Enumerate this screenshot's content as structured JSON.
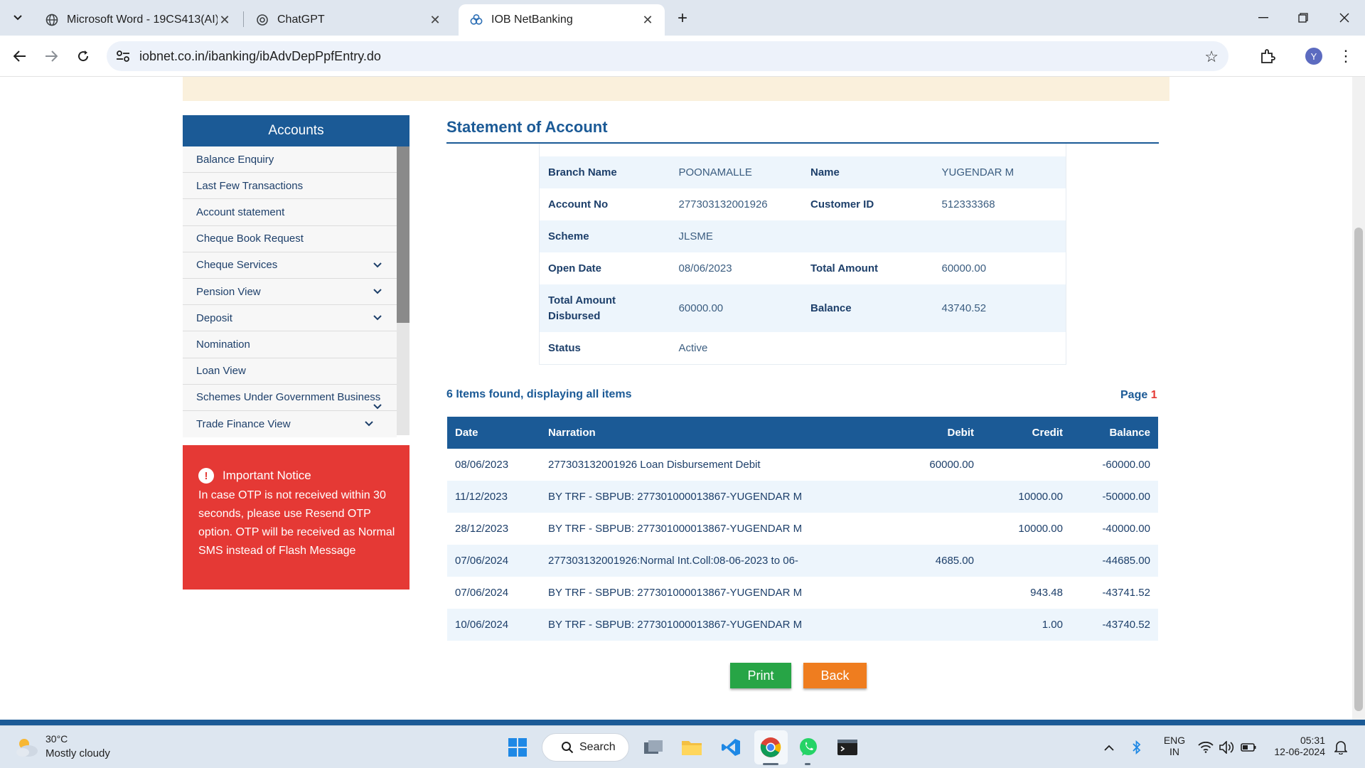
{
  "browser": {
    "tabs": [
      {
        "title": "Microsoft Word - 19CS413(AI)_",
        "icon": "globe-icon"
      },
      {
        "title": "ChatGPT",
        "icon": "chatgpt-icon"
      },
      {
        "title": "IOB NetBanking",
        "icon": "iob-logo-icon"
      }
    ],
    "url": "iobnet.co.in/ibanking/ibAdvDepPpfEntry.do",
    "profile_initial": "Y"
  },
  "sidebar": {
    "title": "Accounts",
    "items": [
      {
        "label": "Balance Enquiry"
      },
      {
        "label": "Last Few Transactions"
      },
      {
        "label": "Account statement"
      },
      {
        "label": "Cheque Book Request"
      },
      {
        "label": "Cheque Services"
      },
      {
        "label": "Pension View"
      },
      {
        "label": "Deposit"
      },
      {
        "label": "Nomination"
      },
      {
        "label": "Loan View"
      },
      {
        "label": "Schemes Under Government Business"
      },
      {
        "label": "Trade Finance View"
      }
    ]
  },
  "notice": {
    "title": "Important Notice",
    "text": "In case OTP is not received within 30 seconds, please use Resend OTP option. OTP will be received as Normal SMS instead of Flash Message"
  },
  "statement": {
    "title": "Statement of Account",
    "details": {
      "branch_name_label": "Branch Name",
      "branch_name": "POONAMALLE",
      "name_label": "Name",
      "name": "YUGENDAR M",
      "account_no_label": "Account No",
      "account_no": "277303132001926",
      "customer_id_label": "Customer ID",
      "customer_id": "512333368",
      "scheme_label": "Scheme",
      "scheme": "JLSME",
      "open_date_label": "Open Date",
      "open_date": "08/06/2023",
      "total_amount_label": "Total Amount",
      "total_amount": "60000.00",
      "total_disbursed_label": "Total Amount Disbursed",
      "total_disbursed": "60000.00",
      "balance_label": "Balance",
      "balance": "43740.52",
      "status_label": "Status",
      "status": "Active"
    },
    "items_found": "6 Items found, displaying all items",
    "page_label": "Page",
    "page_number": "1",
    "columns": {
      "date": "Date",
      "narration": "Narration",
      "debit": "Debit",
      "credit": "Credit",
      "balance": "Balance"
    },
    "rows": [
      {
        "date": "08/06/2023",
        "narration": "277303132001926 Loan Disbursement Debit",
        "debit": "60000.00",
        "credit": "",
        "balance": "-60000.00"
      },
      {
        "date": "11/12/2023",
        "narration": "BY TRF - SBPUB: 277301000013867-YUGENDAR M",
        "debit": "",
        "credit": "10000.00",
        "balance": "-50000.00"
      },
      {
        "date": "28/12/2023",
        "narration": "BY TRF - SBPUB: 277301000013867-YUGENDAR M",
        "debit": "",
        "credit": "10000.00",
        "balance": "-40000.00"
      },
      {
        "date": "07/06/2024",
        "narration": "277303132001926:Normal Int.Coll:08-06-2023 to 06-",
        "debit": "4685.00",
        "credit": "",
        "balance": "-44685.00"
      },
      {
        "date": "07/06/2024",
        "narration": "BY TRF - SBPUB: 277301000013867-YUGENDAR M",
        "debit": "",
        "credit": "943.48",
        "balance": "-43741.52"
      },
      {
        "date": "10/06/2024",
        "narration": "BY TRF - SBPUB: 277301000013867-YUGENDAR M",
        "debit": "",
        "credit": "1.00",
        "balance": "-43740.52"
      }
    ],
    "print_label": "Print",
    "back_label": "Back"
  },
  "taskbar": {
    "temperature": "30°C",
    "weather": "Mostly cloudy",
    "search_label": "Search",
    "lang_line1": "ENG",
    "lang_line2": "IN",
    "time": "05:31",
    "date": "12-06-2024"
  },
  "colors": {
    "primary_blue": "#1b5a96",
    "notice_red": "#e53935",
    "print_green": "#27a546",
    "back_orange": "#ef7d1f",
    "row_alt": "#edf5fc"
  }
}
